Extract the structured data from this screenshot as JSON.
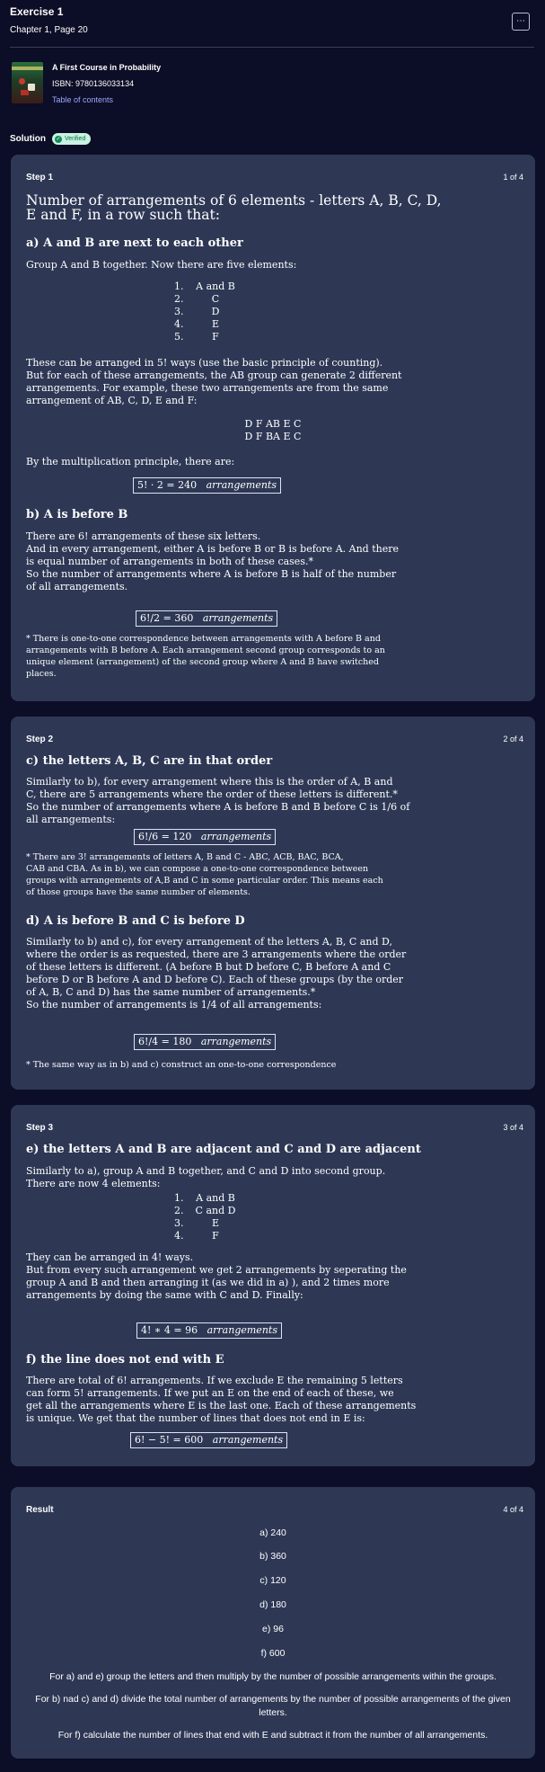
{
  "header": {
    "title": "Exercise 1",
    "subtitle": "Chapter 1, Page 20",
    "more_icon": "⋯"
  },
  "book": {
    "title": "A First Course in Probability",
    "isbn": "ISBN: 9780136033134",
    "toc_label": "Table of contents"
  },
  "solution": {
    "label": "Solution",
    "badge": "Verified"
  },
  "step1": {
    "title": "Step 1",
    "count": "1 of 4",
    "intro": [
      "Number of arrangements of 6 elements - letters A, B, C, D,",
      "E and F, in a row such that:"
    ],
    "a_heading": "a) A and B are next to each other",
    "a_text": "Group A and B together. Now there are five elements:",
    "list": [
      {
        "n": "1.",
        "v": "A and B"
      },
      {
        "n": "2.",
        "v": "C"
      },
      {
        "n": "3.",
        "v": "D"
      },
      {
        "n": "4.",
        "v": "E"
      },
      {
        "n": "5.",
        "v": "F"
      }
    ],
    "a_para": [
      "These can be arranged in 5! ways (use the basic principle of counting).",
      "But for each of these arrangements, the AB group can generate 2 different",
      "arrangements.  For example, these two arrangements are from the same",
      "arrangement of AB, C, D, E and F:"
    ],
    "ex1": "D F AB E C",
    "ex2": "D F BA E C",
    "mult_text": "By the multiplication principle, there are:",
    "a_result": "5! · 2 = 240",
    "word_arr": "arrangements",
    "b_heading": "b) A is before B",
    "b_para": [
      "There are 6! arrangements of these six letters.",
      "And in every arrangement, either A is before B or B is before A. And there",
      "is equal number of arrangements in both of these cases.*",
      "So the number of arrangements where A is before B is half of the number",
      "of all arrangements."
    ],
    "b_result": "6!/2 = 360",
    "b_note": [
      "* There is one-to-one correspondence between arrangements with A before B and",
      "arrangements with B before A. Each arrangement second group corresponds to an",
      "unique element (arrangement) of the second group where A and B have switched",
      "places."
    ]
  },
  "step2": {
    "title": "Step 2",
    "count": "2 of 4",
    "c_heading": "c) the letters A, B, C are in that order",
    "c_para": [
      "Similarly to b), for every arrangement where this is the order of A, B and",
      "C, there are 5 arrangements where the order of these letters is different.*",
      "So the number of arrangements where A is before B and B before C is 1/6 of",
      "all arrangements:"
    ],
    "c_result": "6!/6 = 120",
    "c_note": [
      "* There are 3!  arrangements of letters A, B and C - ABC, ACB, BAC, BCA,",
      "CAB and CBA. As in b), we can compose a one-to-one correspondence between",
      "groups with arrangements of A,B and C in some particular order. This means each",
      "of those groups have the same number of elements."
    ],
    "d_heading": "d) A is before B and C is before D",
    "d_para": [
      "Similarly to b) and c), for every arrangement of the letters A, B, C and D,",
      "where the order is as requested, there are 3 arrangements where the order",
      "of these letters is different. (A before B but D before C, B before A and C",
      "before D or B before A and D before C). Each of these groups (by the order",
      "of A, B, C and D) has the same number of arrangements.*",
      "So the number of arrangements is 1/4 of all arrangements:"
    ],
    "d_result": "6!/4 = 180",
    "d_note": "* The same way as in b) and c) construct an one-to-one correspondence"
  },
  "step3": {
    "title": "Step 3",
    "count": "3 of 4",
    "e_heading": "e) the letters A and B are adjacent and C and D are adjacent",
    "e_para1": [
      "Similarly to a), group A and B together, and C and D into second group.",
      "There are now 4 elements:"
    ],
    "list": [
      {
        "n": "1.",
        "v": "A and B"
      },
      {
        "n": "2.",
        "v": "C and D"
      },
      {
        "n": "3.",
        "v": "E"
      },
      {
        "n": "4.",
        "v": "F"
      }
    ],
    "e_para2": [
      "They can be arranged in 4! ways.",
      "But from every such arrangement we get 2 arrangements by seperating the",
      "group A and B and then arranging it (as we did in a) ), and 2 times more",
      "arrangements by doing the same with C and D. Finally:"
    ],
    "e_result": "4! ∗ 4 = 96",
    "f_heading": "f) the line does not end with E",
    "f_para": [
      "There are total of 6! arrangements. If we exclude E the remaining 5 letters",
      "can form 5! arrangements. If we put an E on the end of each of these, we",
      "get all the arrangements where E is the last one. Each of these arrangements",
      "is unique. We get that the number of lines that does not end in E is:"
    ],
    "f_result": "6! − 5! = 600"
  },
  "result": {
    "title": "Result",
    "count": "4 of 4",
    "answers": [
      "a) 240",
      "b) 360",
      "c) 120",
      "d) 180",
      "e) 96",
      "f) 600"
    ],
    "notes": [
      "For a) and e) group the letters and then multiply by the number of possible arrangements within the groups.",
      "For b) nad c) and d) divide the total number of arrangements by the number of possible arrangements of the given",
      "letters.",
      "For f) calculate the number of lines that end with E and subtract it from the number of all arrangements."
    ]
  }
}
